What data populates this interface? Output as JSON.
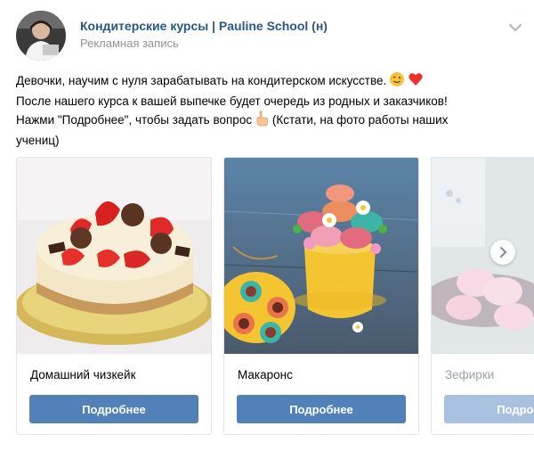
{
  "post": {
    "author": "Кондитерские курсы | Pauline School (н)",
    "subtitle": "Рекламная запись",
    "text_lines": [
      "Девочки, научим с нуля зарабатывать на кондитерском искусстве.",
      "После нашего курса к вашей выпечке будет очередь из родных и заказчиков!",
      "Нажми \"Подробнее\", чтобы задать вопрос",
      "(Кстати, на фото работы наших",
      "учениц)"
    ]
  },
  "icons": {
    "menu": "chevron-down-icon",
    "emoji_wink": "winking-face-icon",
    "emoji_heart": "red-heart-icon",
    "emoji_pointing": "pointing-hand-icon",
    "next": "chevron-right-icon"
  },
  "carousel": {
    "cards": [
      {
        "title": "Домашний чизкейк",
        "button": "Подробнее"
      },
      {
        "title": "Макаронс",
        "button": "Подробнее"
      },
      {
        "title": "Зефирки",
        "button": "Подробнее"
      }
    ]
  },
  "colors": {
    "link": "#2a5885",
    "button": "#5181b8",
    "muted": "#939393"
  }
}
